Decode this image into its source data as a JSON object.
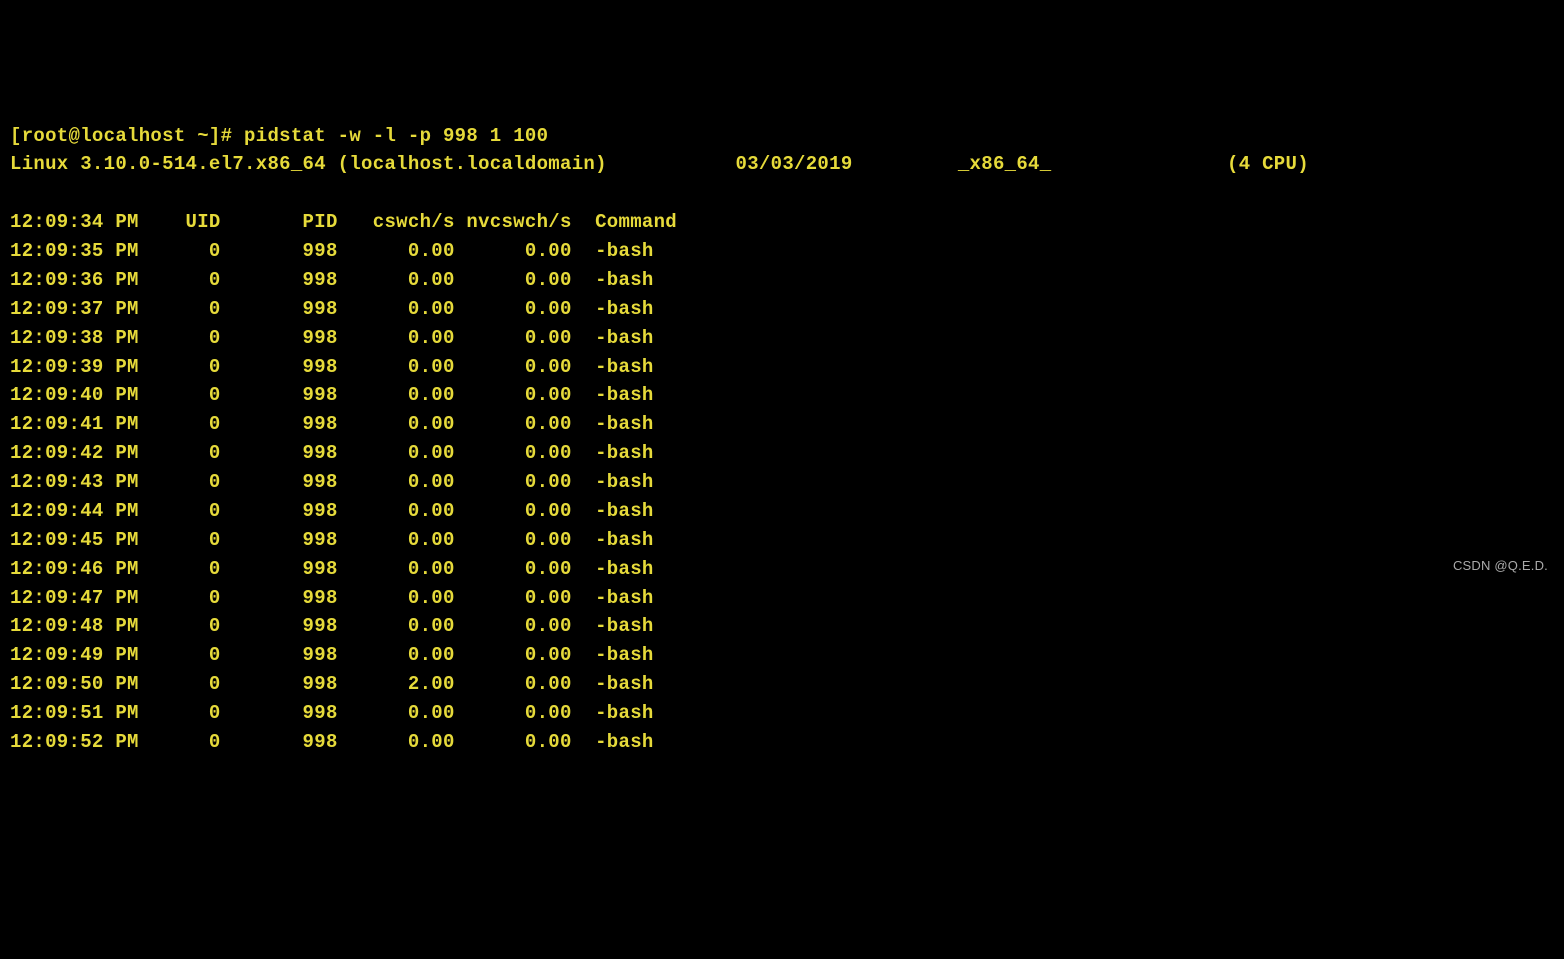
{
  "prompt": "[root@localhost ~]# ",
  "command": "pidstat -w -l -p 998 1 100",
  "sysinfo": {
    "kernel": "Linux 3.10.0-514.el7.x86_64 (localhost.localdomain)",
    "date": "03/03/2019",
    "arch": "_x86_64_",
    "cpu": "(4 CPU)"
  },
  "columns": [
    "Time",
    "AMPM",
    "UID",
    "PID",
    "cswch/s",
    "nvcswch/s",
    "Command"
  ],
  "header_time": "12:09:34",
  "header_ampm": "PM",
  "rows": [
    {
      "time": "12:09:35",
      "ampm": "PM",
      "uid": "0",
      "pid": "998",
      "cswch": "0.00",
      "nvcswch": "0.00",
      "cmd": "-bash"
    },
    {
      "time": "12:09:36",
      "ampm": "PM",
      "uid": "0",
      "pid": "998",
      "cswch": "0.00",
      "nvcswch": "0.00",
      "cmd": "-bash"
    },
    {
      "time": "12:09:37",
      "ampm": "PM",
      "uid": "0",
      "pid": "998",
      "cswch": "0.00",
      "nvcswch": "0.00",
      "cmd": "-bash"
    },
    {
      "time": "12:09:38",
      "ampm": "PM",
      "uid": "0",
      "pid": "998",
      "cswch": "0.00",
      "nvcswch": "0.00",
      "cmd": "-bash"
    },
    {
      "time": "12:09:39",
      "ampm": "PM",
      "uid": "0",
      "pid": "998",
      "cswch": "0.00",
      "nvcswch": "0.00",
      "cmd": "-bash"
    },
    {
      "time": "12:09:40",
      "ampm": "PM",
      "uid": "0",
      "pid": "998",
      "cswch": "0.00",
      "nvcswch": "0.00",
      "cmd": "-bash"
    },
    {
      "time": "12:09:41",
      "ampm": "PM",
      "uid": "0",
      "pid": "998",
      "cswch": "0.00",
      "nvcswch": "0.00",
      "cmd": "-bash"
    },
    {
      "time": "12:09:42",
      "ampm": "PM",
      "uid": "0",
      "pid": "998",
      "cswch": "0.00",
      "nvcswch": "0.00",
      "cmd": "-bash"
    },
    {
      "time": "12:09:43",
      "ampm": "PM",
      "uid": "0",
      "pid": "998",
      "cswch": "0.00",
      "nvcswch": "0.00",
      "cmd": "-bash"
    },
    {
      "time": "12:09:44",
      "ampm": "PM",
      "uid": "0",
      "pid": "998",
      "cswch": "0.00",
      "nvcswch": "0.00",
      "cmd": "-bash"
    },
    {
      "time": "12:09:45",
      "ampm": "PM",
      "uid": "0",
      "pid": "998",
      "cswch": "0.00",
      "nvcswch": "0.00",
      "cmd": "-bash"
    },
    {
      "time": "12:09:46",
      "ampm": "PM",
      "uid": "0",
      "pid": "998",
      "cswch": "0.00",
      "nvcswch": "0.00",
      "cmd": "-bash"
    },
    {
      "time": "12:09:47",
      "ampm": "PM",
      "uid": "0",
      "pid": "998",
      "cswch": "0.00",
      "nvcswch": "0.00",
      "cmd": "-bash"
    },
    {
      "time": "12:09:48",
      "ampm": "PM",
      "uid": "0",
      "pid": "998",
      "cswch": "0.00",
      "nvcswch": "0.00",
      "cmd": "-bash"
    },
    {
      "time": "12:09:49",
      "ampm": "PM",
      "uid": "0",
      "pid": "998",
      "cswch": "0.00",
      "nvcswch": "0.00",
      "cmd": "-bash"
    },
    {
      "time": "12:09:50",
      "ampm": "PM",
      "uid": "0",
      "pid": "998",
      "cswch": "2.00",
      "nvcswch": "0.00",
      "cmd": "-bash"
    },
    {
      "time": "12:09:51",
      "ampm": "PM",
      "uid": "0",
      "pid": "998",
      "cswch": "0.00",
      "nvcswch": "0.00",
      "cmd": "-bash"
    },
    {
      "time": "12:09:52",
      "ampm": "PM",
      "uid": "0",
      "pid": "998",
      "cswch": "0.00",
      "nvcswch": "0.00",
      "cmd": "-bash"
    }
  ],
  "watermark": "CSDN @Q.E.D."
}
